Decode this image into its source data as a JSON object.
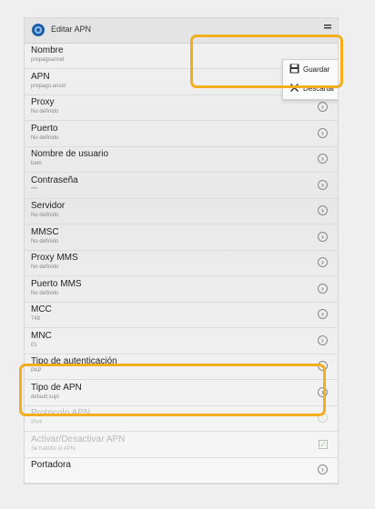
{
  "header": {
    "title": "Editar APN",
    "app_icon": "settings-gear-icon",
    "overflow_icon": "menu-icon"
  },
  "rows": [
    {
      "label": "Nombre",
      "value": "prepagoancel",
      "control": "none",
      "enabled": true
    },
    {
      "label": "APN",
      "value": "prepago.ancel",
      "control": "chevron",
      "enabled": true
    },
    {
      "label": "Proxy",
      "value": "No definido",
      "control": "chevron",
      "enabled": true
    },
    {
      "label": "Puerto",
      "value": "No definido",
      "control": "chevron",
      "enabled": true
    },
    {
      "label": "Nombre de usuario",
      "value": "bam",
      "control": "chevron",
      "enabled": true
    },
    {
      "label": "Contraseña",
      "value": "***",
      "control": "chevron",
      "enabled": true
    },
    {
      "label": "Servidor",
      "value": "No definido",
      "control": "chevron",
      "enabled": true
    },
    {
      "label": "MMSC",
      "value": "No definido",
      "control": "chevron",
      "enabled": true
    },
    {
      "label": "Proxy MMS",
      "value": "No definido",
      "control": "chevron",
      "enabled": true
    },
    {
      "label": "Puerto MMS",
      "value": "No definido",
      "control": "chevron",
      "enabled": true
    },
    {
      "label": "MCC",
      "value": "748",
      "control": "chevron",
      "enabled": true
    },
    {
      "label": "MNC",
      "value": "01",
      "control": "chevron",
      "enabled": true
    },
    {
      "label": "Tipo de autenticación",
      "value": "PAP",
      "control": "chevron",
      "enabled": true
    },
    {
      "label": "Tipo de APN",
      "value": "default,supl",
      "control": "chevron",
      "enabled": true
    },
    {
      "label": "Protocolo APN",
      "value": "IPv4",
      "control": "chevron",
      "enabled": false
    },
    {
      "label": "Activar/Desactivar APN",
      "value": "Se habilitó el APN.",
      "control": "checkbox",
      "enabled": false
    },
    {
      "label": "Portadora",
      "value": "",
      "control": "chevron",
      "enabled": true
    }
  ],
  "menu": {
    "items": [
      {
        "label": "Guardar",
        "icon": "save-icon"
      },
      {
        "label": "Descartar",
        "icon": "close-icon"
      }
    ]
  },
  "colors": {
    "highlight": "#f2ae1d"
  }
}
